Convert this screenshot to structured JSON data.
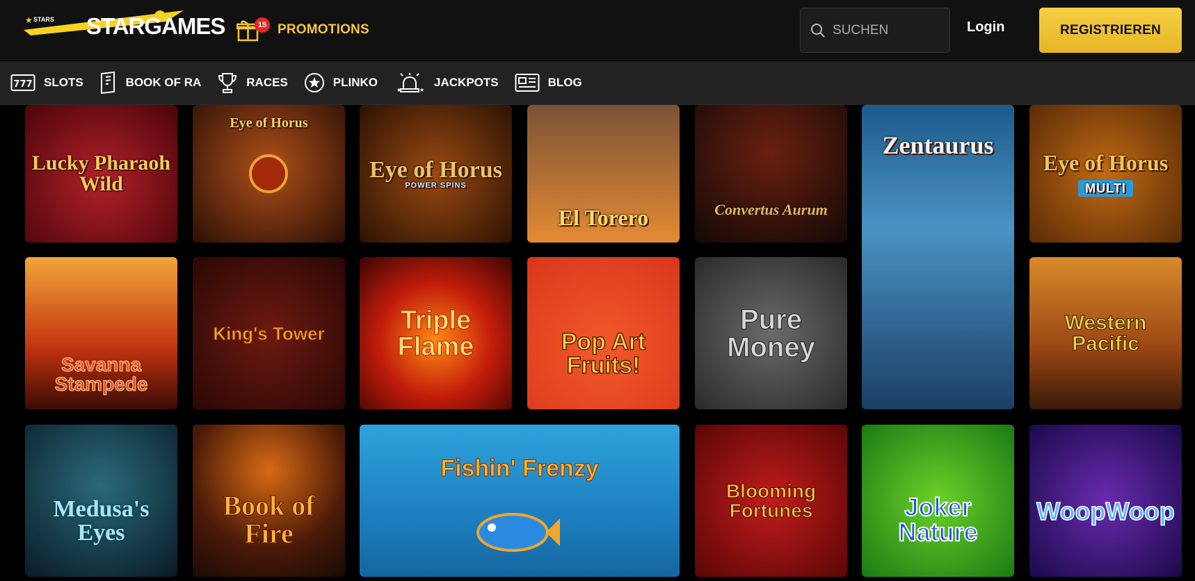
{
  "header": {
    "logo_text": "STARGAMES",
    "logo_sub": "STARS",
    "promotions": {
      "label": "PROMOTIONS",
      "count": "15"
    },
    "search": {
      "placeholder": "SUCHEN"
    },
    "login_label": "Login",
    "register_label": "REGISTRIEREN"
  },
  "nav": {
    "items": [
      {
        "label": "SLOTS",
        "icon": "slots-777-icon"
      },
      {
        "label": "BOOK OF RA",
        "icon": "book-icon"
      },
      {
        "label": "RACES",
        "icon": "trophy-icon"
      },
      {
        "label": "PLINKO",
        "icon": "star-circle-icon"
      },
      {
        "label": "JACKPOTS",
        "icon": "jackpot-siren-icon"
      },
      {
        "label": "BLOG",
        "icon": "blog-icon"
      }
    ]
  },
  "games": [
    {
      "title": "Lucky Pharaoh Wild"
    },
    {
      "title": "Eye of Horus"
    },
    {
      "title": "Eye of Horus",
      "subtitle": "POWER SPINS"
    },
    {
      "title": "El Torero"
    },
    {
      "title": "Convertus Aurum"
    },
    {
      "title": "Zentaurus"
    },
    {
      "title": "Eye of Horus",
      "subtitle": "MULTI"
    },
    {
      "title": "Savanna Stampede"
    },
    {
      "title": "King's Tower"
    },
    {
      "title": "Triple Flame"
    },
    {
      "title": "Pop Art Fruits!"
    },
    {
      "title": "Pure Money"
    },
    {
      "title": "Western Pacific"
    },
    {
      "title": "Medusa's Eyes"
    },
    {
      "title": "Book of Fire"
    },
    {
      "title": "Fishin' Frenzy"
    },
    {
      "title": "Blooming Fortunes"
    },
    {
      "title": "Joker Nature"
    },
    {
      "title": "WoopWoop"
    }
  ],
  "colors": {
    "accent": "#f5c53a",
    "header_bg": "#111111",
    "nav_bg": "#222222",
    "badge": "#e5262a"
  }
}
